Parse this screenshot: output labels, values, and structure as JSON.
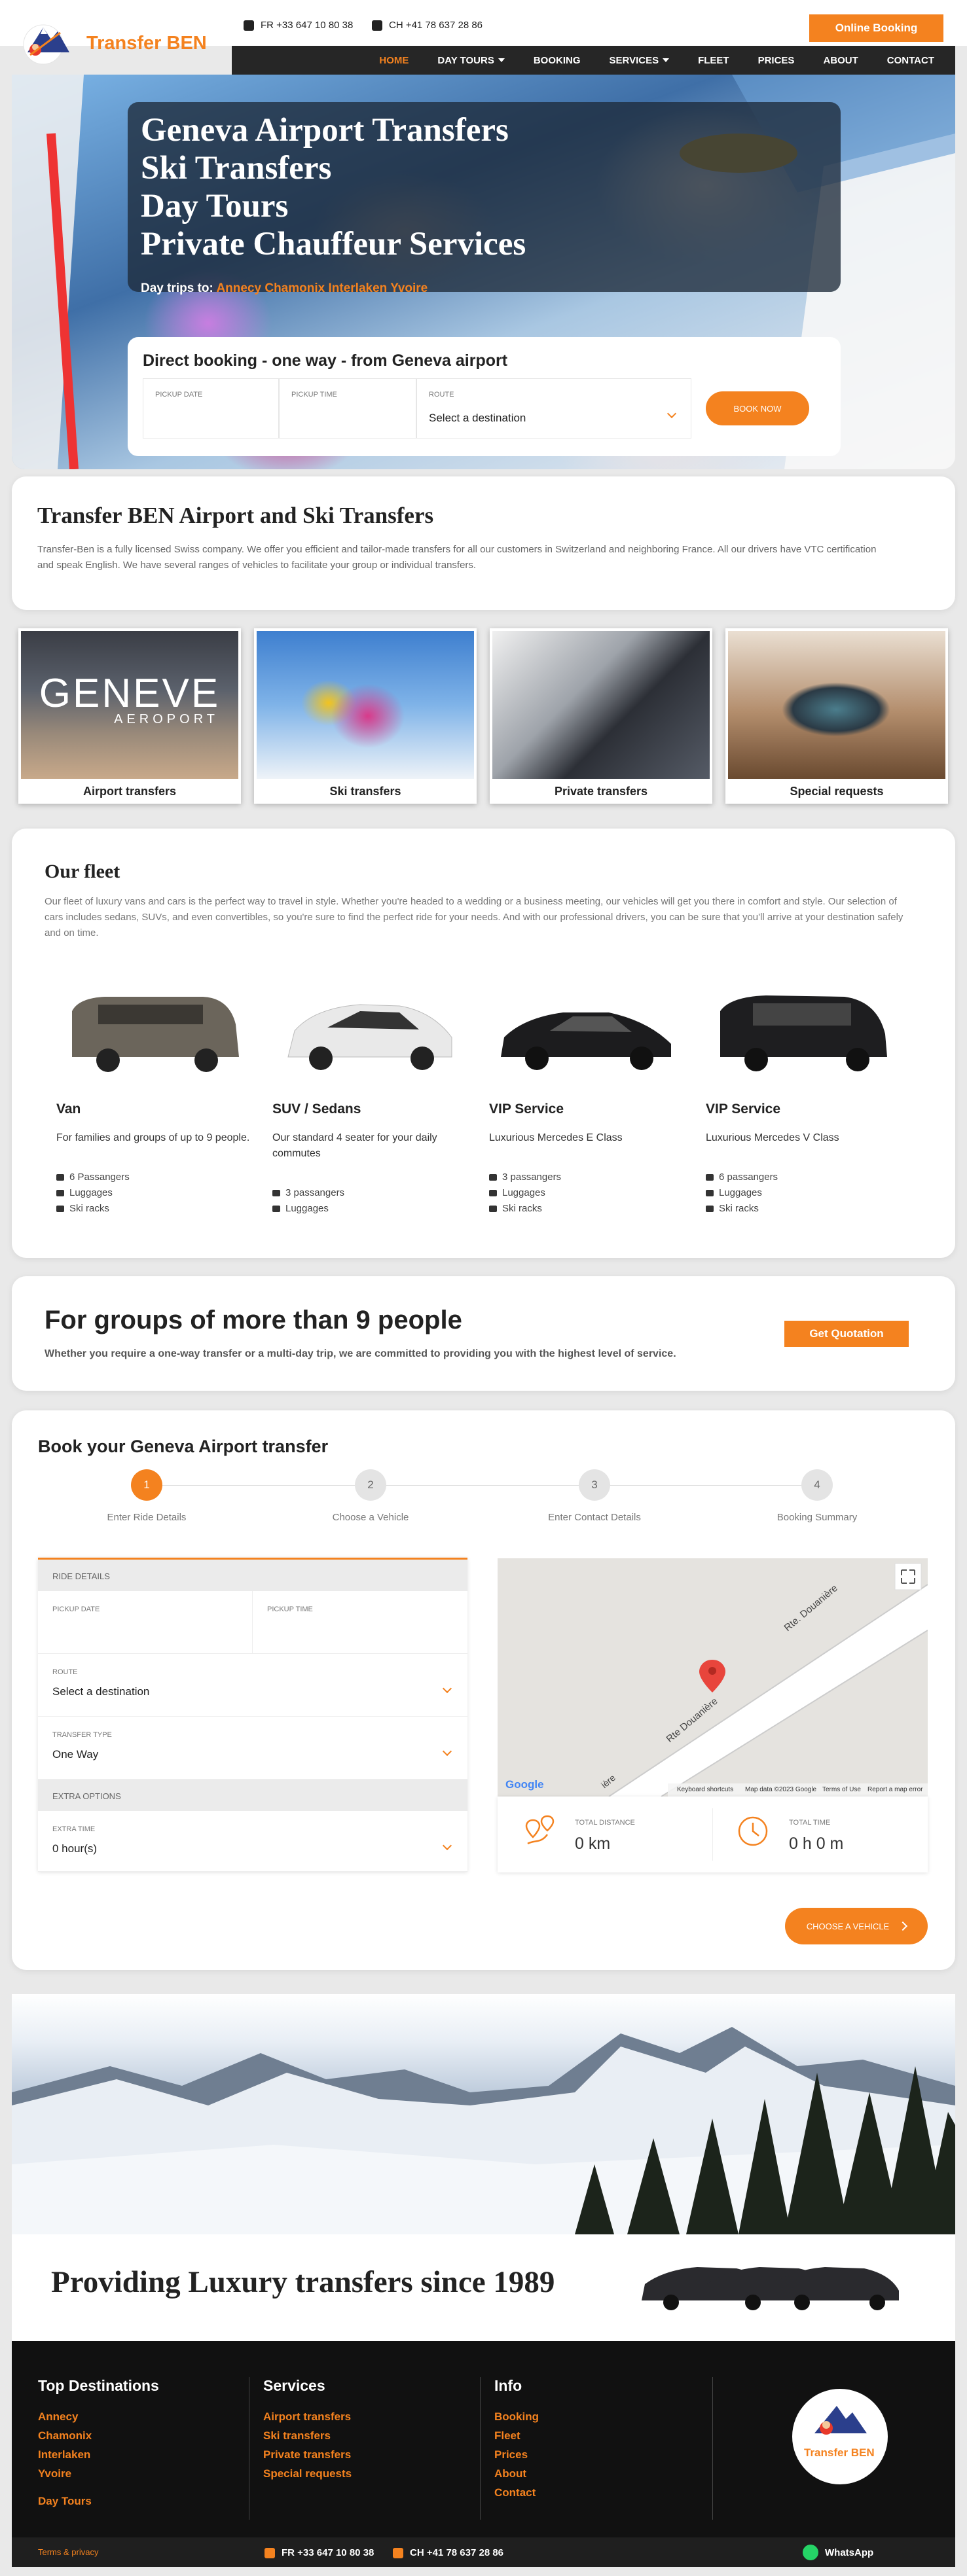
{
  "header": {
    "brand": "Transfer BEN",
    "phone_fr": "FR +33 647 10 80 38",
    "phone_ch": "CH +41 78 637 28 86",
    "online_booking": "Online Booking"
  },
  "nav": {
    "items": [
      "HOME",
      "DAY TOURS",
      "BOOKING",
      "SERVICES",
      "FLEET",
      "PRICES",
      "ABOUT",
      "CONTACT"
    ]
  },
  "hero": {
    "lines": [
      "Geneva Airport Transfers",
      "Ski Transfers",
      "Day Tours",
      "Private Chauffeur Services"
    ],
    "daytrips_label": "Day trips to:",
    "daytrips_links": [
      "Annecy",
      "Chamonix",
      "Interlaken",
      "Yvoire"
    ]
  },
  "quickbook": {
    "title": "Direct booking - one way - from Geneva airport",
    "pickup_date": "PICKUP DATE",
    "pickup_time": "PICKUP TIME",
    "route": "ROUTE",
    "route_value": "Select a destination",
    "book_now": "BOOK NOW"
  },
  "intro": {
    "title": "Transfer BEN Airport and Ski Transfers",
    "text": "Transfer-Ben is a fully licensed Swiss company. We offer you efficient and tailor-made transfers for all our customers in Switzerland and neighboring France. All our drivers have VTC certification and speak English. We have several ranges of vehicles to facilitate your group or individual transfers."
  },
  "services": [
    {
      "label": "Airport transfers",
      "image_text": "GENEVE",
      "image_sub": "AEROPORT"
    },
    {
      "label": "Ski transfers"
    },
    {
      "label": "Private transfers"
    },
    {
      "label": "Special requests"
    }
  ],
  "fleet": {
    "title": "Our fleet",
    "text": "Our fleet of luxury vans and cars is the perfect way to travel in style. Whether you're headed to a wedding or a business meeting, our vehicles will get you there in comfort and style. Our selection of cars includes sedans, SUVs, and even convertibles, so you're sure to find the perfect ride for your needs. And with our professional drivers, you can be sure that you'll arrive at your destination safely and on time.",
    "vehicles": [
      {
        "name": "Van",
        "desc": "For families and groups of up to 9 people.",
        "features": [
          "6 Passangers",
          "Luggages",
          "Ski racks"
        ],
        "color": "#6b655b"
      },
      {
        "name": "SUV / Sedans",
        "desc": "Our standard 4 seater for your daily commutes",
        "features": [
          "3 passangers",
          "Luggages"
        ],
        "color": "#e9e9e9"
      },
      {
        "name": "VIP Service",
        "desc": "Luxurious Mercedes E Class",
        "features": [
          "3 passangers",
          "Luggages",
          "Ski racks"
        ],
        "color": "#1c1c1e"
      },
      {
        "name": "VIP Service",
        "desc": "Luxurious Mercedes V Class",
        "features": [
          "6 passangers",
          "Luggages",
          "Ski racks"
        ],
        "color": "#1e1e20"
      }
    ]
  },
  "groups": {
    "title": "For groups of more than 9 people",
    "text": "Whether you require a one-way transfer or a multi-day trip, we are committed to providing you with the highest level of service.",
    "button": "Get Quotation"
  },
  "wizard": {
    "title": "Book your Geneva Airport transfer",
    "steps": [
      {
        "num": "1",
        "label": "Enter Ride Details"
      },
      {
        "num": "2",
        "label": "Choose a Vehicle"
      },
      {
        "num": "3",
        "label": "Enter Contact Details"
      },
      {
        "num": "4",
        "label": "Booking Summary"
      }
    ],
    "ride_details": "RIDE DETAILS",
    "pickup_date": "PICKUP DATE",
    "pickup_time": "PICKUP TIME",
    "route": "ROUTE",
    "route_value": "Select a destination",
    "transfer_type": "TRANSFER TYPE",
    "transfer_value": "One Way",
    "extra_options": "EXTRA OPTIONS",
    "extra_time": "EXTRA TIME",
    "extra_time_value": "0 hour(s)",
    "total_distance": "TOTAL DISTANCE",
    "distance_value": "0 km",
    "total_time": "TOTAL TIME",
    "time_value": "0 h 0 m",
    "choose_vehicle": "CHOOSE A VEHICLE",
    "map": {
      "road_1": "Rte. Douanière",
      "road_2": "Rte Douanière",
      "road_3": "ière",
      "google": "Google",
      "footer": [
        "Keyboard shortcuts",
        "Map data ©2023 Google",
        "Terms of Use",
        "Report a map error"
      ]
    }
  },
  "luxury": {
    "title": "Providing Luxury transfers since 1989"
  },
  "footer": {
    "top_destinations": "Top Destinations",
    "destinations": [
      "Annecy",
      "Chamonix",
      "Interlaken",
      "Yvoire"
    ],
    "day_tours": "Day Tours",
    "services_title": "Services",
    "services": [
      "Airport transfers",
      "Ski transfers",
      "Private transfers",
      "Special requests"
    ],
    "info_title": "Info",
    "info": [
      "Booking",
      "Fleet",
      "Prices",
      "About",
      "Contact"
    ],
    "terms": "Terms & privacy",
    "phone_fr": "FR +33 647 10 80 38",
    "phone_ch": "CH +41 78 637 28 86",
    "whatsapp": "WhatsApp"
  },
  "colors": {
    "accent": "#f4821f",
    "dark": "#262626",
    "footer": "#111111"
  }
}
